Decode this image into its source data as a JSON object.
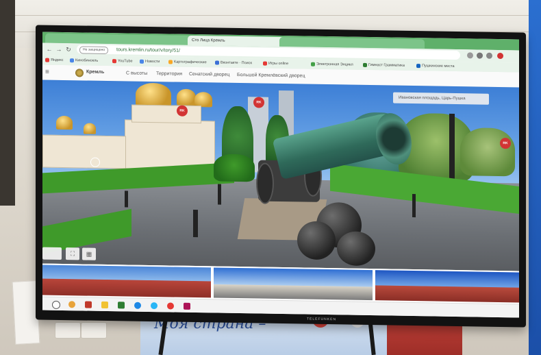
{
  "browser": {
    "tabs": [
      {
        "label": "",
        "active": false
      },
      {
        "label": "",
        "active": false
      },
      {
        "label": "Сто Лица Кремль",
        "active": true
      },
      {
        "label": "",
        "active": false
      }
    ],
    "security_chip": "Не защищено",
    "url": "tours.kremlin.ru/tour/v/tory/51/",
    "bookmarks": [
      {
        "label": "Яндекс",
        "color": "#e53935"
      },
      {
        "label": "Кинобинокль",
        "color": "#4a86e8"
      },
      {
        "label": "YouTube",
        "color": "#e53935"
      },
      {
        "label": "Новости",
        "color": "#4a86e8"
      },
      {
        "label": "Картографические",
        "color": "#f9a825"
      },
      {
        "label": "Вконтакте · Поиск",
        "color": "#3b6fd6"
      },
      {
        "label": "Игры online",
        "color": "#e53935"
      },
      {
        "label": "Электронная Энцикл",
        "color": "#43a047"
      },
      {
        "label": "Гимнаст Грамматика",
        "color": "#2e7d32"
      },
      {
        "label": "Пушкинские места",
        "color": "#1565c0"
      }
    ]
  },
  "site": {
    "name": "Кремль",
    "nav": [
      "С высоты",
      "Территория",
      "Сенатский дворец",
      "Большой Кремлёвский дворец"
    ]
  },
  "panorama": {
    "place_search": "Ивановская площадь, Царь-Пушка",
    "badge": "RK"
  },
  "tv": {
    "brand": "TELEFUNKEN"
  },
  "poster": {
    "text": "Моя страна –"
  },
  "colors": {
    "browser_green": "#5fb06a",
    "sky": "#3d7fd6",
    "cannon": "#2f6a5a",
    "lawn": "#3f9a2a"
  }
}
